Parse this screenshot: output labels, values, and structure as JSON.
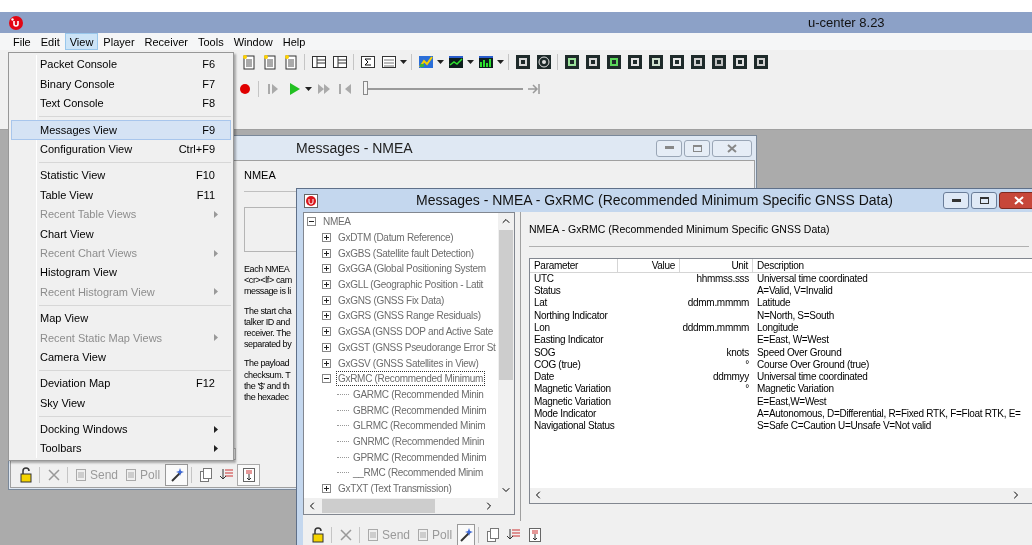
{
  "app": {
    "title": "u-center 8.23"
  },
  "menu_bar": [
    {
      "label": "File",
      "selected": false
    },
    {
      "label": "Edit",
      "selected": false
    },
    {
      "label": "View",
      "selected": true
    },
    {
      "label": "Player",
      "selected": false
    },
    {
      "label": "Receiver",
      "selected": false
    },
    {
      "label": "Tools",
      "selected": false
    },
    {
      "label": "Window",
      "selected": false
    },
    {
      "label": "Help",
      "selected": false
    }
  ],
  "view_menu": {
    "sections": [
      {
        "items": [
          {
            "label": "Packet Console",
            "shortcut": "F6",
            "disabled": false,
            "submenu": false,
            "selected": false
          },
          {
            "label": "Binary Console",
            "shortcut": "F7",
            "disabled": false,
            "submenu": false,
            "selected": false
          },
          {
            "label": "Text Console",
            "shortcut": "F8",
            "disabled": false,
            "submenu": false,
            "selected": false
          }
        ]
      },
      {
        "items": [
          {
            "label": "Messages View",
            "shortcut": "F9",
            "disabled": false,
            "submenu": false,
            "selected": true
          },
          {
            "label": "Configuration View",
            "shortcut": "Ctrl+F9",
            "disabled": false,
            "submenu": false,
            "selected": false
          }
        ]
      },
      {
        "items": [
          {
            "label": "Statistic View",
            "shortcut": "F10",
            "disabled": false,
            "submenu": false,
            "selected": false
          },
          {
            "label": "Table View",
            "shortcut": "F11",
            "disabled": false,
            "submenu": false,
            "selected": false
          },
          {
            "label": "Recent Table Views",
            "disabled": true,
            "submenu": true,
            "selected": false
          },
          {
            "label": "Chart View",
            "disabled": false,
            "submenu": false,
            "selected": false
          },
          {
            "label": "Recent Chart Views",
            "disabled": true,
            "submenu": true,
            "selected": false
          },
          {
            "label": "Histogram View",
            "disabled": false,
            "submenu": false,
            "selected": false
          },
          {
            "label": "Recent Histogram View",
            "disabled": true,
            "submenu": true,
            "selected": false
          }
        ]
      },
      {
        "items": [
          {
            "label": "Map View",
            "disabled": false,
            "submenu": false,
            "selected": false
          },
          {
            "label": "Recent Static Map Views",
            "disabled": true,
            "submenu": true,
            "selected": false
          },
          {
            "label": "Camera View",
            "disabled": false,
            "submenu": false,
            "selected": false
          }
        ]
      },
      {
        "items": [
          {
            "label": "Deviation Map",
            "shortcut": "F12",
            "disabled": false,
            "submenu": false,
            "selected": false
          },
          {
            "label": "Sky View",
            "disabled": false,
            "submenu": false,
            "selected": false
          }
        ]
      },
      {
        "items": [
          {
            "label": "Docking Windows",
            "disabled": false,
            "submenu": true,
            "selected": false
          },
          {
            "label": "Toolbars",
            "disabled": false,
            "submenu": true,
            "selected": false
          }
        ]
      }
    ]
  },
  "player": {
    "level": 0
  },
  "back_window": {
    "title": "Messages - NMEA",
    "active": false,
    "heading": "NMEA",
    "paragraphs": [
      "Each NMEA\n<cr><lf> cam\nmessage is li",
      "The start cha\ntalker ID and\nreceiver. The\nseparated by",
      "The payload\nchecksum. T\nthe '$' and th\nthe hexadec"
    ],
    "toolbar": [
      {
        "label": "Send",
        "disabled": true
      },
      {
        "label": "Poll",
        "disabled": true
      }
    ]
  },
  "front_window": {
    "title": "Messages - NMEA - GxRMC (Recommended Minimum Specific GNSS Data)",
    "active": true,
    "tree": [
      {
        "label": "NMEA",
        "expanded": true,
        "selected": false,
        "children": [
          {
            "label": "GxDTM (Datum Reference)",
            "expanded": false,
            "selected": false
          },
          {
            "label": "GxGBS (Satellite fault Detection)",
            "expanded": false,
            "selected": false
          },
          {
            "label": "GxGGA (Global Positioning System",
            "expanded": false,
            "selected": false
          },
          {
            "label": "GxGLL (Geographic Position - Latit",
            "expanded": false,
            "selected": false
          },
          {
            "label": "GxGNS (GNSS Fix Data)",
            "expanded": false,
            "selected": false
          },
          {
            "label": "GxGRS (GNSS Range Residuals)",
            "expanded": false,
            "selected": false
          },
          {
            "label": "GxGSA (GNSS DOP and Active Sate",
            "expanded": false,
            "selected": false
          },
          {
            "label": "GxGST (GNSS Pseudorange Error St",
            "expanded": false,
            "selected": false
          },
          {
            "label": "GxGSV (GNSS Satellites in View)",
            "expanded": false,
            "selected": false
          },
          {
            "label": "GxRMC (Recommended Minimum",
            "expanded": true,
            "selected": true,
            "children": [
              {
                "label": "GARMC (Recommended Minin",
                "selected": false
              },
              {
                "label": "GBRMC (Recommended Minim",
                "selected": false
              },
              {
                "label": "GLRMC (Recommended Minim",
                "selected": false
              },
              {
                "label": "GNRMC (Recommended Minin",
                "selected": false
              },
              {
                "label": "GPRMC (Recommended Minim",
                "selected": false
              },
              {
                "label": "__RMC (Recommended Minim",
                "selected": false
              }
            ]
          },
          {
            "label": "GxTXT (Text Transmission)",
            "expanded": false,
            "selected": false
          }
        ]
      }
    ],
    "header": "NMEA - GxRMC (Recommended Minimum Specific GNSS Data)",
    "table": {
      "columns": [
        "Parameter",
        "Value",
        "Unit",
        "Description"
      ],
      "rows": [
        [
          "UTC",
          "",
          "hhmmss.sss",
          "Universal time coordinated"
        ],
        [
          "Status",
          "",
          "",
          "A=Valid, V=Invalid"
        ],
        [
          "Lat",
          "",
          "ddmm.mmmm",
          "Latitude"
        ],
        [
          "Northing Indicator",
          "",
          "",
          "N=North, S=South"
        ],
        [
          "Lon",
          "",
          "dddmm.mmmm",
          "Longitude"
        ],
        [
          "Easting Indicator",
          "",
          "",
          "E=East, W=West"
        ],
        [
          "SOG",
          "",
          "knots",
          "Speed Over Ground"
        ],
        [
          "COG (true)",
          "",
          "°",
          "Course Over Ground (true)"
        ],
        [
          "Date",
          "",
          "ddmmyy",
          "Universal time coordinated"
        ],
        [
          "Magnetic Variation",
          "",
          "°",
          "Magnetic Variation"
        ],
        [
          "Magnetic Variation",
          "",
          "",
          "E=East,W=West"
        ],
        [
          "Mode Indicator",
          "",
          "",
          "A=Autonomous, D=Differential, R=Fixed RTK, F=Float RTK, E="
        ],
        [
          "Navigational Status",
          "",
          "",
          "S=Safe C=Caution U=Unsafe V=Not valid"
        ]
      ]
    },
    "toolbar": [
      {
        "label": "Send",
        "disabled": true
      },
      {
        "label": "Poll",
        "disabled": true
      }
    ]
  }
}
